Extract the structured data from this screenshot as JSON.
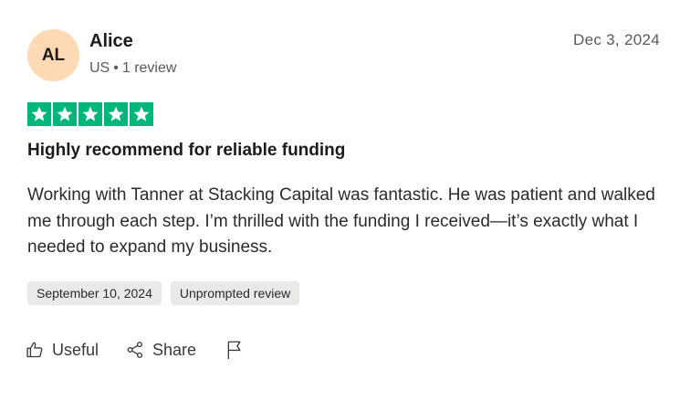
{
  "reviewer": {
    "initials": "AL",
    "name": "Alice",
    "country": "US",
    "separator": "•",
    "review_count": "1 review"
  },
  "review": {
    "date": "Dec 3, 2024",
    "rating": 5,
    "title": "Highly recommend for reliable funding",
    "body": "Working with Tanner at Stacking Capital was fantastic. He was patient and walked me through each step. I’m thrilled with the funding I received—it’s exactly what I needed to expand my business.",
    "experience_date": "September 10, 2024",
    "review_type": "Unprompted review"
  },
  "actions": {
    "useful_label": "Useful",
    "share_label": "Share",
    "useful_icon": "thumbs-up-icon",
    "share_icon": "share-icon",
    "report_icon": "flag-icon"
  },
  "colors": {
    "star_green": "#00b67a",
    "avatar_bg": "#ffd9b3",
    "tag_bg": "#e9e9e7"
  }
}
